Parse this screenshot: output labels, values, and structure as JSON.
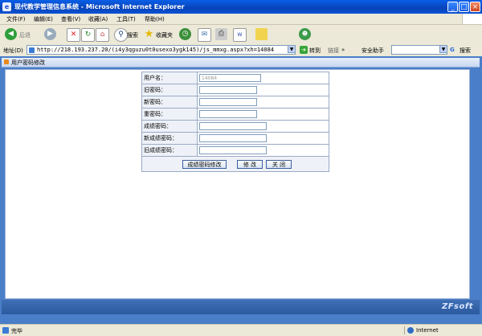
{
  "window": {
    "title": "现代教学管理信息系统 - Microsoft Internet Explorer",
    "minimize": "_",
    "maximize": "□",
    "close": "×"
  },
  "menu": [
    "文件(F)",
    "编辑(E)",
    "查看(V)",
    "收藏(A)",
    "工具(T)",
    "帮助(H)"
  ],
  "toolbar": {
    "back": "后退",
    "search": "搜索",
    "favorites": "收藏夹"
  },
  "address": {
    "label": "地址(D)",
    "url": "http://218.193.237.20/(i4y3qguzu0t0usexo3ygk145)/js_mmxg.aspx?xh=14084",
    "go": "转到",
    "links": "链接",
    "safety": "安全助手",
    "search_label": "搜索"
  },
  "breadcrumb": "用户密码修改",
  "form": {
    "rows": [
      {
        "label": "用户名：",
        "value": "14084",
        "readonly": true
      },
      {
        "label": "旧密码：",
        "value": ""
      },
      {
        "label": "新密码：",
        "value": ""
      },
      {
        "label": "重密码：",
        "value": ""
      },
      {
        "label": "成绩密码：",
        "value": ""
      },
      {
        "label": "新成绩密码：",
        "value": ""
      },
      {
        "label": "旧成绩密码：",
        "value": ""
      }
    ],
    "buttons": {
      "grade_pwd": "成绩密码修改",
      "modify": "修 改",
      "close": "关 闭"
    }
  },
  "footer": {
    "logo": "ZFsoft"
  },
  "status": {
    "text": "完毕",
    "zone": "Internet"
  },
  "colors": {
    "titlebar": "#0a53d6",
    "client_bg": "#4a7ec8",
    "form_label_bg": "#eef2f8"
  }
}
